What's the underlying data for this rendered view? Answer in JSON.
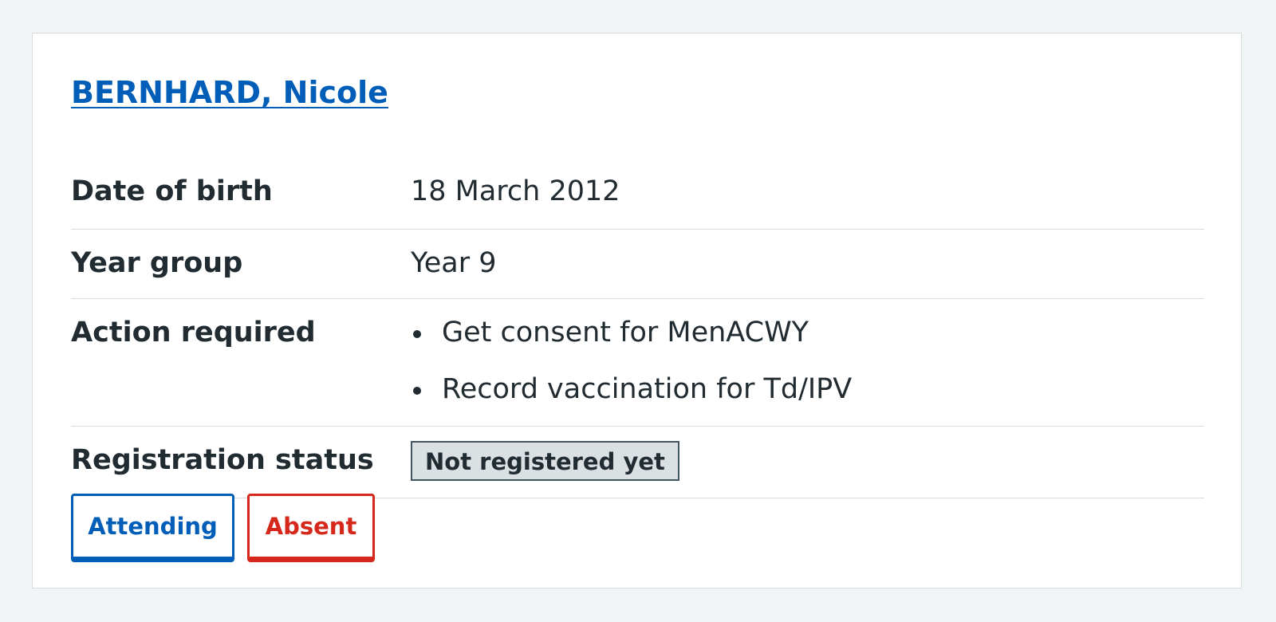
{
  "patient": {
    "name": "BERNHARD, Nicole"
  },
  "summary": {
    "dob_label": "Date of birth",
    "dob_value": "18 March 2012",
    "year_label": "Year group",
    "year_value": "Year 9",
    "action_label": "Action required",
    "actions": [
      "Get consent for MenACWY",
      "Record vaccination for Td/IPV"
    ],
    "registration_label": "Registration status",
    "registration_value": "Not registered yet"
  },
  "buttons": {
    "attending_label": "Attending",
    "absent_label": "Absent"
  },
  "colors": {
    "link": "#005eb8",
    "danger": "#d5281b",
    "text": "#212b32",
    "background": "#f0f4f5",
    "tag_background": "#dbe0e3",
    "tag_border": "#425563"
  }
}
